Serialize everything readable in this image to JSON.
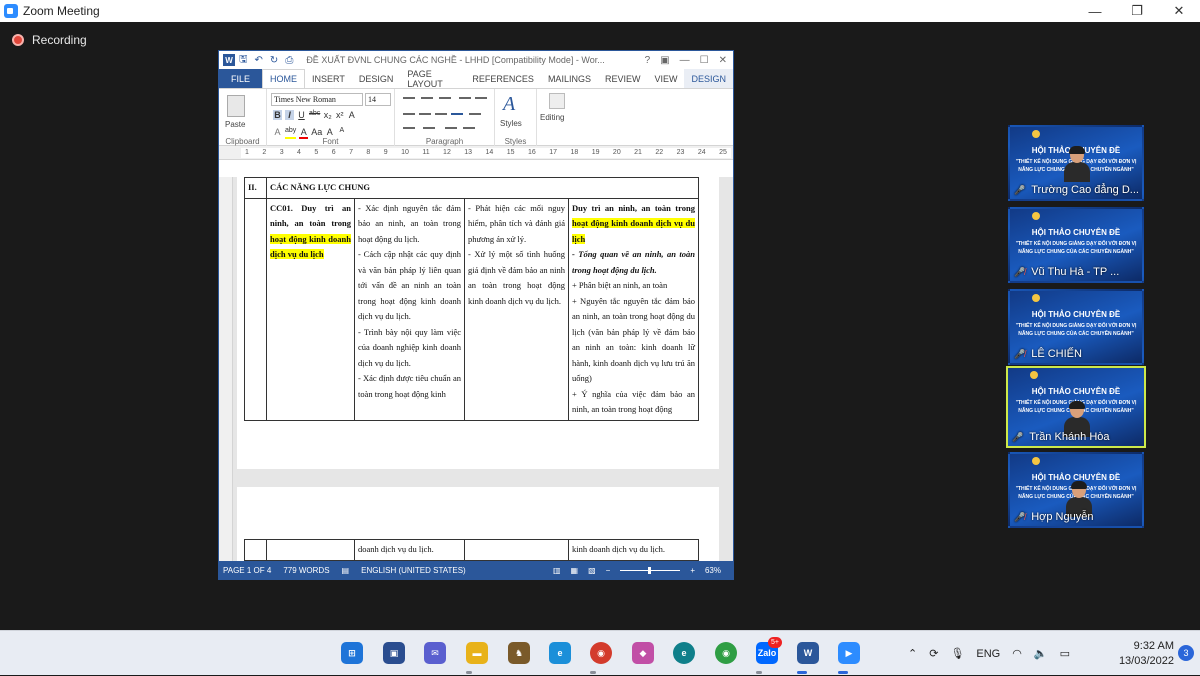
{
  "zoom": {
    "title": "Zoom Meeting",
    "recording_label": "Recording",
    "controls": {
      "minimize": "—",
      "restore": "❐",
      "close": "✕"
    }
  },
  "word": {
    "logo": "W",
    "doc_title": "ĐỀ XUẤT ĐVNL CHUNG CÁC NGHỀ - LHHD [Compatibility Mode] - Wor...",
    "title_controls": [
      "?",
      "▣",
      "—",
      "☐",
      "✕"
    ],
    "tabs": [
      "FILE",
      "HOME",
      "INSERT",
      "DESIGN",
      "PAGE LAYOUT",
      "REFERENCES",
      "MAILINGS",
      "REVIEW",
      "VIEW",
      "DESIGN"
    ],
    "ribbon": {
      "paste_label": "Paste",
      "clipboard_label": "Clipboard",
      "font_name": "Times New Roman",
      "font_size": "14",
      "font_label": "Font",
      "paragraph_label": "Paragraph",
      "styles_label": "Styles",
      "styles_group_label": "Styles",
      "editing_label": "Editing",
      "fmt_row1": [
        "B",
        "I",
        "U",
        "abc",
        "x₂",
        "x²",
        "A"
      ],
      "fmt_row2": [
        "A",
        "aby",
        "A",
        "Aa",
        "A",
        "A"
      ]
    },
    "ruler_ticks": [
      "1",
      "2",
      "3",
      "4",
      "5",
      "6",
      "7",
      "8",
      "9",
      "10",
      "11",
      "12",
      "13",
      "14",
      "15",
      "16",
      "17",
      "18",
      "19",
      "20",
      "21",
      "22",
      "23",
      "24",
      "25"
    ],
    "table": {
      "section_no": "II.",
      "section_title": "CÁC NĂNG LỰC CHUNG",
      "col1_code": "CC01. Duy trì an ninh, an toàn trong",
      "col1_hl": "hoạt động kinh doanh dịch vụ du lịch",
      "col2": [
        "- Xác định nguyên tắc đảm bảo an ninh, an toàn trong hoạt động du lịch.",
        "- Cách cập nhật các quy định và văn bản pháp lý liên quan tới vấn đề an ninh an toàn trong hoạt động kinh doanh dịch vụ du lịch.",
        "- Trình bày nội quy làm việc của doanh nghiệp kinh doanh dịch vụ du lịch.",
        "- Xác định được tiêu chuẩn an toàn trong hoạt động kinh"
      ],
      "col3": [
        "- Phát hiện các mối nguy hiểm, phân tích và đánh giá phương án xử lý.",
        "- Xử lý một số tình huống giả định về đảm bảo an ninh an toàn trong hoạt động kinh doanh dịch vụ du lịch."
      ],
      "col4_title": "Duy trì an ninh, an toàn trong",
      "col4_title_hl": "hoạt động kinh doanh dịch vụ du lịch",
      "col4_sub": "- Tổng quan về an ninh, an toàn trong hoạt động du lịch.",
      "col4_items": [
        "+ Phân biệt an ninh, an toàn",
        "+ Nguyên tắc nguyên tắc đảm bảo an ninh, an toàn trong hoạt động du lịch (văn bản pháp lý về đảm bảo an ninh an toàn: kinh doanh lữ hành, kinh doanh dịch vụ lưu trú ăn uống)",
        "+ Ý nghĩa của việc đảm bảo an ninh, an toàn trong hoạt động"
      ],
      "next_col2": "doanh dịch vụ du lịch.",
      "next_col4": "kinh doanh dịch vụ du lịch."
    },
    "vruler_text": "1 · · · 2",
    "status": {
      "page": "PAGE 1 OF 4",
      "words": "779 WORDS",
      "lang": "ENGLISH (UNITED STATES)",
      "zoom": "63%",
      "minus": "−",
      "plus": "+"
    }
  },
  "participants": [
    {
      "name": "Trường Cao đẳng D...",
      "slide_title": "HỘI THẢO CHUYÊN ĐỀ",
      "slide_sub": "\"THIẾT KẾ NỘI DUNG GIẢNG DẠY ĐỐI VỚI ĐƠN VỊ NĂNG LỰC CHUNG CỦA CÁC CHUYÊN NGÀNH\"",
      "muted": false
    },
    {
      "name": "Vũ Thu Hà - TP ...",
      "slide_title": "HỘI THẢO CHUYÊN ĐỀ",
      "slide_sub": "\"THIẾT KẾ NỘI DUNG GIẢNG DẠY ĐỐI VỚI ĐƠN VỊ NĂNG LỰC CHUNG CỦA CÁC CHUYÊN NGÀNH\"",
      "muted": true
    },
    {
      "name": "LÊ CHIẾN",
      "slide_title": "HỘI THẢO CHUYÊN ĐỀ",
      "slide_sub": "\"THIẾT KẾ NỘI DUNG GIẢNG DẠY ĐỐI VỚI ĐƠN VỊ NĂNG LỰC CHUNG CỦA CÁC CHUYÊN NGÀNH\"",
      "muted": true
    },
    {
      "name": "Trần Khánh Hòa",
      "slide_title": "HỘI THẢO CHUYÊN ĐỀ",
      "slide_sub": "\"THIẾT KẾ NỘI DUNG GIẢNG DẠY ĐỐI VỚI ĐƠN VỊ NĂNG LỰC CHUNG CỦA CÁC CHUYÊN NGÀNH\"",
      "muted": false,
      "active": true
    },
    {
      "name": "Hợp Nguyễn",
      "slide_title": "HỘI THẢO CHUYÊN ĐỀ",
      "slide_sub": "\"THIẾT KẾ NỘI DUNG GIẢNG DẠY ĐỐI VỚI ĐƠN VỊ NĂNG LỰC CHUNG CỦA CÁC CHUYÊN NGÀNH\"",
      "muted": true
    }
  ],
  "taskbar": {
    "zalo_badge": "5+",
    "zalo_label": "Zalo",
    "word_label": "W",
    "lang": "ENG",
    "time": "9:32 AM",
    "date": "13/03/2022",
    "notifications": "3"
  },
  "colors": {
    "word_blue": "#2b579a",
    "highlight": "#ffff00",
    "active_speaker": "#cde94a",
    "recording_red": "#e0463a"
  }
}
